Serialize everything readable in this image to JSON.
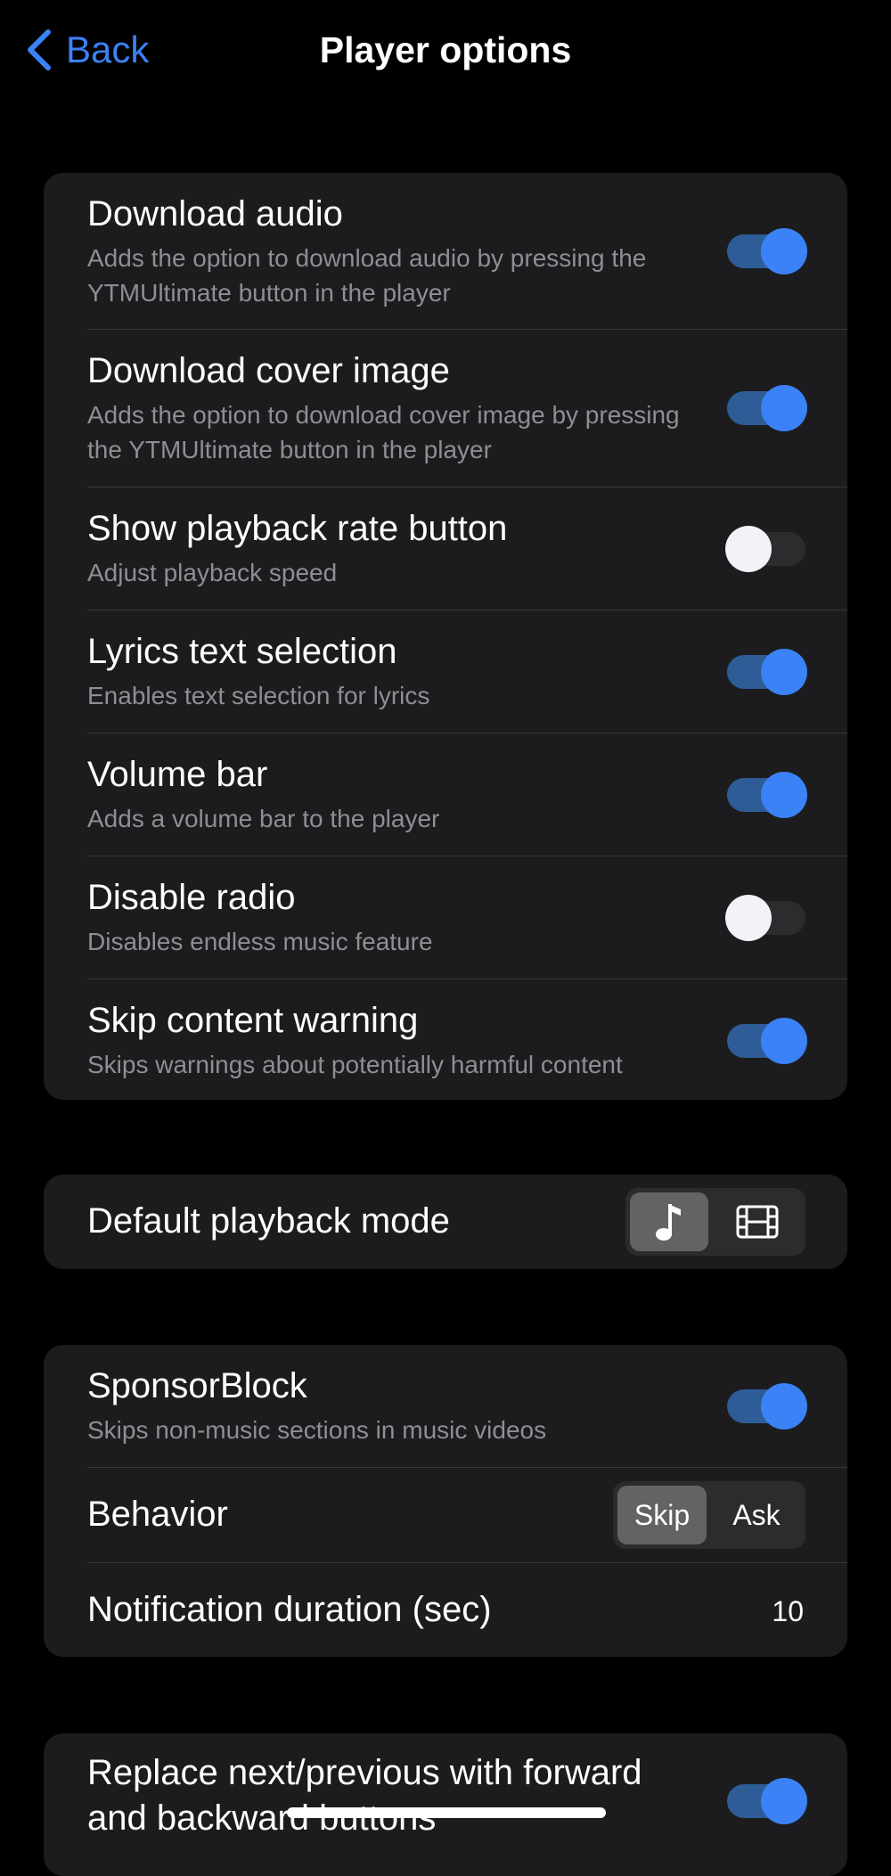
{
  "nav": {
    "back_label": "Back",
    "title": "Player options"
  },
  "group1": [
    {
      "title": "Download audio",
      "subtitle": "Adds the option to download audio by pressing the YTMUltimate button in the player",
      "on": true
    },
    {
      "title": "Download cover image",
      "subtitle": "Adds the option to download cover image by pressing the YTMUltimate button in the player",
      "on": true
    },
    {
      "title": "Show playback rate button",
      "subtitle": "Adjust playback speed",
      "on": false
    },
    {
      "title": "Lyrics text selection",
      "subtitle": "Enables text selection for lyrics",
      "on": true
    },
    {
      "title": "Volume bar",
      "subtitle": "Adds a volume bar to the player",
      "on": true
    },
    {
      "title": "Disable radio",
      "subtitle": "Disables endless music feature",
      "on": false
    },
    {
      "title": "Skip content warning",
      "subtitle": "Skips warnings about potentially harmful content",
      "on": true
    }
  ],
  "playback_mode": {
    "label": "Default playback mode",
    "options": [
      {
        "icon": "music-note-icon",
        "selected": true
      },
      {
        "icon": "film-icon",
        "selected": false
      }
    ]
  },
  "sponsorblock": {
    "title": "SponsorBlock",
    "subtitle": "Skips non-music sections in music videos",
    "on": true,
    "behavior": {
      "label": "Behavior",
      "options": [
        "Skip",
        "Ask"
      ],
      "selected": "Skip"
    },
    "notification": {
      "label": "Notification duration (sec)",
      "value": "10"
    }
  },
  "group4": [
    {
      "title_line1": "Replace next/previous with forward",
      "title_line2": "and backward buttons",
      "on": true
    }
  ],
  "colors": {
    "accent": "#3b82f6",
    "toggle_track_on": "#2e5c96",
    "card": "#1c1c1e",
    "background": "#000000"
  }
}
